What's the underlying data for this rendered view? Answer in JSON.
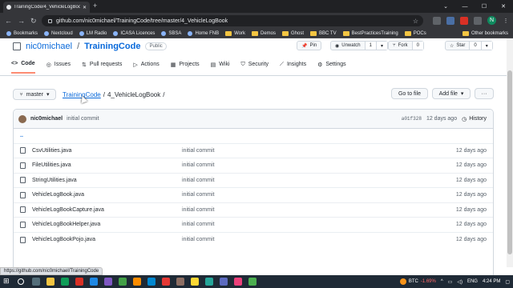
{
  "browser": {
    "tab_title": "TrainingCode/4_VehicleLogBoo...",
    "url": "github.com/nic0michael/TrainingCode/tree/master/4_VehicleLogBook",
    "profile_initial": "N",
    "bookmarks": [
      "Bookmarks",
      "Nextcloud",
      "LM Radio",
      "ICASA Licences",
      "SBSA",
      "Home FNB",
      "Work",
      "Demos",
      "Ghost",
      "BBC TV",
      "BestPracticesTraining",
      "POCs"
    ],
    "other_bookmarks": "Other bookmarks"
  },
  "repo": {
    "owner": "nic0michael",
    "name": "TrainingCode",
    "visibility": "Public",
    "pin": "Pin",
    "unwatch": "Unwatch",
    "watch_count": "1",
    "fork": "Fork",
    "fork_count": "0",
    "star": "Star",
    "star_count": "0"
  },
  "tabs": [
    "Code",
    "Issues",
    "Pull requests",
    "Actions",
    "Projects",
    "Wiki",
    "Security",
    "Insights",
    "Settings"
  ],
  "branch": "master",
  "breadcrumb": {
    "root": "TrainingCode",
    "sep": "/",
    "folder": "4_VehicleLogBook",
    "trail": "/"
  },
  "buttons": {
    "go_to_file": "Go to file",
    "add_file": "Add file",
    "more": "···"
  },
  "latest_commit": {
    "author": "nic0michael",
    "message": "initial commit",
    "sha": "a01f328",
    "age": "12 days ago",
    "history": "History"
  },
  "up_dir": "..",
  "files": [
    {
      "name": "CsvUtilities.java",
      "message": "initial commit",
      "age": "12 days ago"
    },
    {
      "name": "FileUtilities.java",
      "message": "initial commit",
      "age": "12 days ago"
    },
    {
      "name": "StringUtilities.java",
      "message": "initial commit",
      "age": "12 days ago"
    },
    {
      "name": "VehicleLogBook.java",
      "message": "initial commit",
      "age": "12 days ago"
    },
    {
      "name": "VehicleLogBookCapture.java",
      "message": "initial commit",
      "age": "12 days ago"
    },
    {
      "name": "VehicleLogBookHelper.java",
      "message": "initial commit",
      "age": "12 days ago"
    },
    {
      "name": "VehicleLogBookPojo.java",
      "message": "initial commit",
      "age": "12 days ago"
    }
  ],
  "status_url": "https://github.com/nic0michael/TrainingCode",
  "taskbar": {
    "btc_label": "BTC",
    "btc_change": "-1.69%",
    "lang": "ENG",
    "time": "4:24 PM"
  },
  "colors": {
    "accent": "#0969da",
    "tab_underline": "#fd8c73",
    "btc": "#f7931a"
  }
}
